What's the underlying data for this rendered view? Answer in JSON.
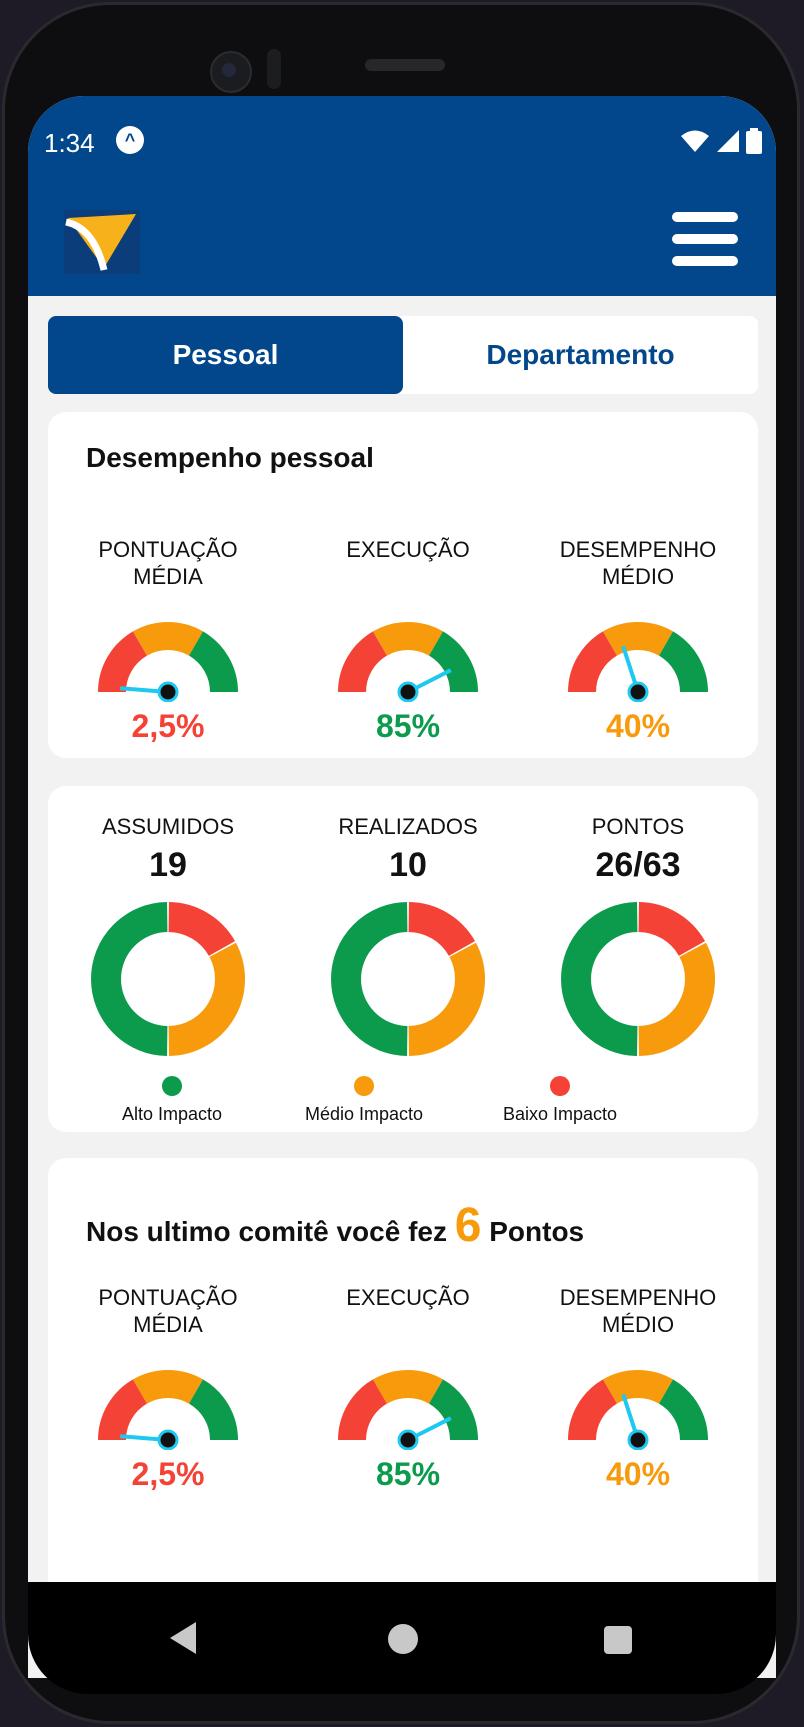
{
  "status": {
    "time": "1:34"
  },
  "tabs": [
    {
      "label": "Pessoal",
      "active": true
    },
    {
      "label": "Departamento",
      "active": false
    }
  ],
  "performance": {
    "title": "Desempenho pessoal",
    "gauges": [
      {
        "label": "PONTUAÇÃO\nMÉDIA",
        "value": "2,5%",
        "level": 0.025,
        "color": "#f44336"
      },
      {
        "label": "EXECUÇÃO",
        "value": "85%",
        "level": 0.85,
        "color": "#0c9b4d"
      },
      {
        "label": "DESEMPENHO\nMÉDIO",
        "value": "40%",
        "level": 0.4,
        "color": "#f79a0b"
      }
    ]
  },
  "summary": {
    "donuts": [
      {
        "label": "ASSUMIDOS",
        "value": "19",
        "shares": {
          "alto": 0.5,
          "medio": 0.33,
          "baixo": 0.17
        }
      },
      {
        "label": "REALIZADOS",
        "value": "10",
        "shares": {
          "alto": 0.5,
          "medio": 0.33,
          "baixo": 0.17
        }
      },
      {
        "label": "PONTOS",
        "value": "26/63",
        "shares": {
          "alto": 0.5,
          "medio": 0.33,
          "baixo": 0.17
        }
      }
    ],
    "legend": [
      {
        "label": "Alto Impacto",
        "color": "#0c9b4d"
      },
      {
        "label": "Médio Impacto",
        "color": "#f79a0b"
      },
      {
        "label": "Baixo Impacto",
        "color": "#f44336"
      }
    ]
  },
  "committee": {
    "title_prefix": "Nos ultimo comitê você fez",
    "points": "6",
    "title_suffix": "Pontos",
    "gauges": [
      {
        "label": "PONTUAÇÃO\nMÉDIA",
        "value": "2,5%",
        "level": 0.025,
        "color": "#f44336"
      },
      {
        "label": "EXECUÇÃO",
        "value": "85%",
        "level": 0.85,
        "color": "#0c9b4d"
      },
      {
        "label": "DESEMPENHO\nMÉDIO",
        "value": "40%",
        "level": 0.4,
        "color": "#f79a0b"
      }
    ]
  },
  "colors": {
    "primary": "#02478b",
    "red": "#f44336",
    "orange": "#f79a0b",
    "green": "#0c9b4d",
    "needle": "#1ec8f0"
  },
  "icons": [
    "app-logo-icon",
    "menu-icon",
    "wifi-icon",
    "signal-icon",
    "battery-icon",
    "back-icon",
    "home-icon",
    "recents-icon"
  ]
}
